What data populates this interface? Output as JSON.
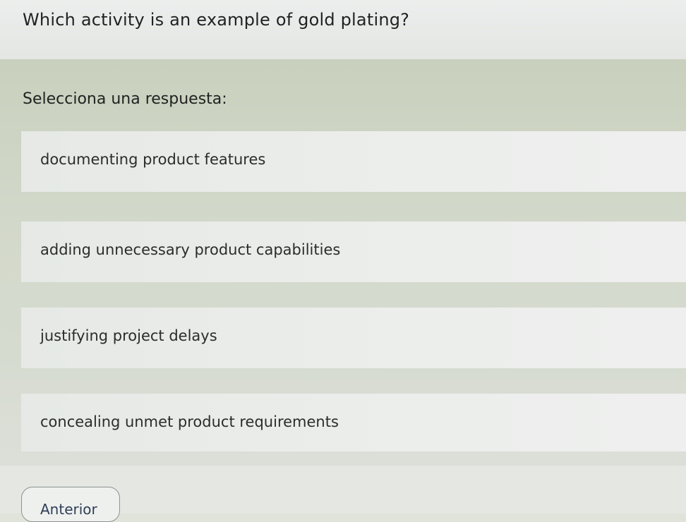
{
  "question": {
    "text": "Which activity is an example of gold plating?"
  },
  "answer_prompt": "Selecciona una respuesta:",
  "options": [
    {
      "label": "documenting product features"
    },
    {
      "label": "adding unnecessary product capabilities"
    },
    {
      "label": "justifying project delays"
    },
    {
      "label": "concealing unmet product requirements"
    }
  ],
  "navigation": {
    "previous_label": "Anterior"
  },
  "colors": {
    "header_background": "#e8eae8",
    "panel_background": "#d2d8c9",
    "option_background": "#eaedea",
    "text": "#1f2220",
    "button_text": "#2f3f57"
  }
}
